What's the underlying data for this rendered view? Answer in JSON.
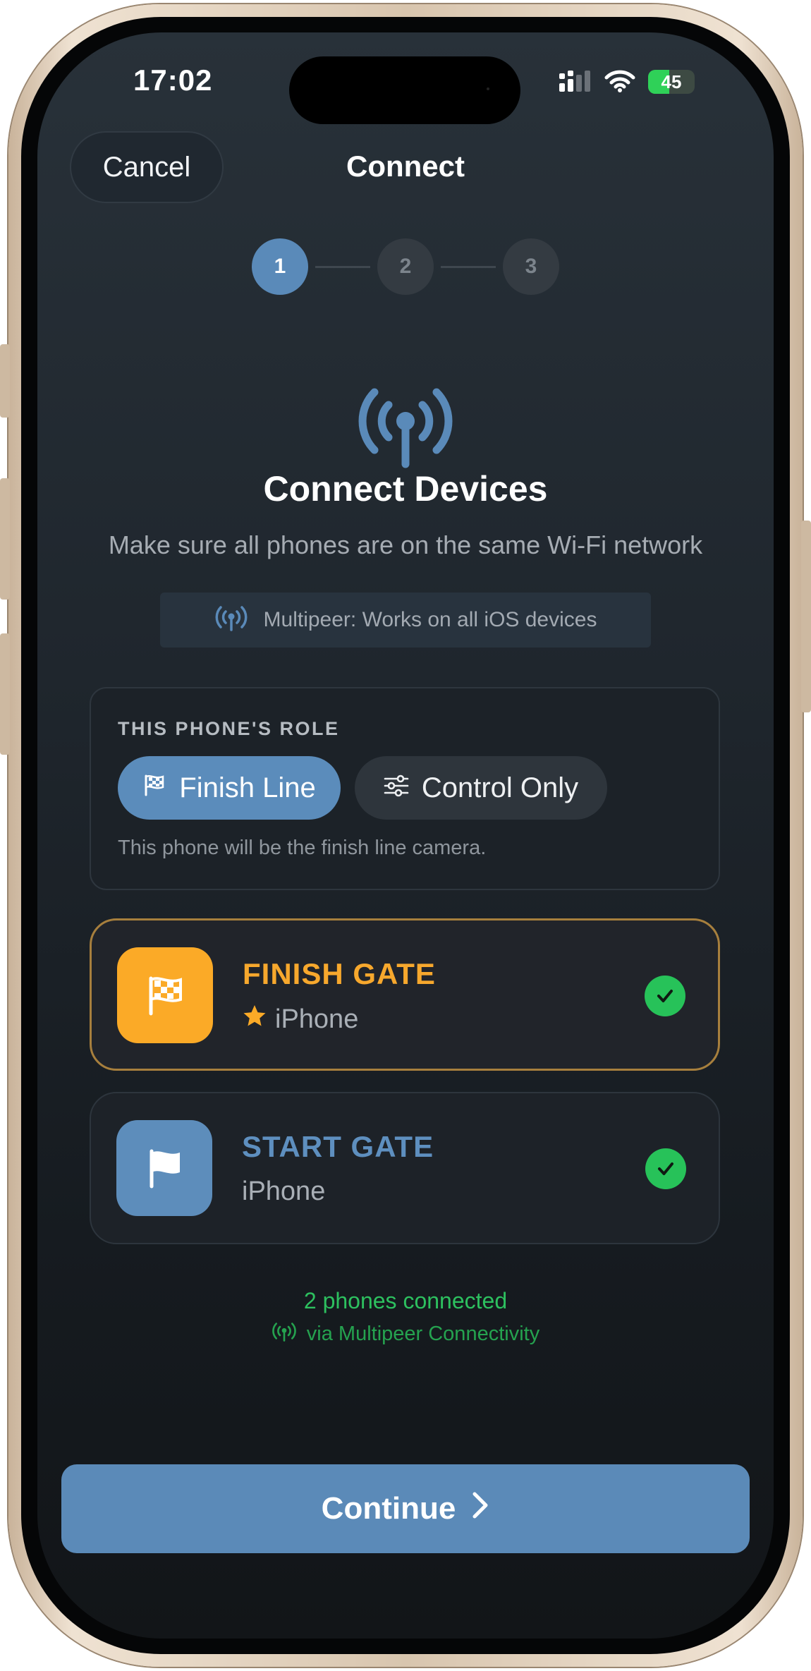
{
  "status_bar": {
    "time": "17:02",
    "battery": "45"
  },
  "nav": {
    "cancel": "Cancel",
    "title": "Connect"
  },
  "stepper": {
    "steps": [
      "1",
      "2",
      "3"
    ],
    "active_step": 1
  },
  "hero": {
    "icon": "antenna-radiowaves-icon",
    "title": "Connect Devices",
    "subtitle": "Make sure all phones are on the same Wi-Fi network"
  },
  "mode_pill": {
    "icon": "antenna-radiowaves-icon",
    "text": "Multipeer: Works on all iOS devices"
  },
  "role": {
    "label": "THIS PHONE'S ROLE",
    "options": [
      {
        "label": "Finish Line",
        "icon": "checkered-flag-icon",
        "selected": true
      },
      {
        "label": "Control Only",
        "icon": "sliders-icon",
        "selected": false
      }
    ],
    "description": "This phone will be the finish line camera."
  },
  "gates": [
    {
      "title": "FINISH GATE",
      "device": "iPhone",
      "icon": "checkered-flag-icon",
      "is_this_device": true,
      "connected": true
    },
    {
      "title": "START GATE",
      "device": "iPhone",
      "icon": "flag-icon",
      "is_this_device": false,
      "connected": true
    }
  ],
  "connection": {
    "count_text": "2 phones connected",
    "via_text": "via Multipeer Connectivity"
  },
  "continue_button": {
    "label": "Continue"
  },
  "colors": {
    "accent_blue": "#5b8ab8",
    "finish_orange": "#fbaa27",
    "success_green": "#2dc05f",
    "screen_background": "#1f262d"
  }
}
